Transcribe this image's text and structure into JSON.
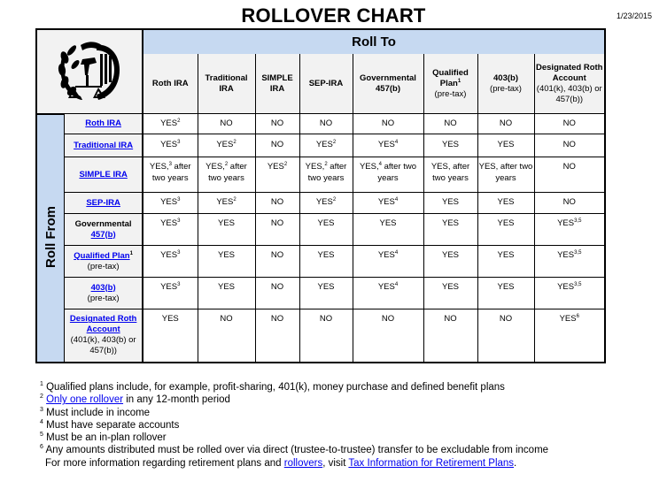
{
  "title": "ROLLOVER CHART",
  "date": "1/23/2015",
  "roll_to_label": "Roll To",
  "roll_from_label": "Roll From",
  "columns": [
    {
      "name": "Roth IRA",
      "sup": "",
      "sub": ""
    },
    {
      "name": "Traditional IRA",
      "sup": "",
      "sub": ""
    },
    {
      "name": "SIMPLE IRA",
      "sup": "",
      "sub": ""
    },
    {
      "name": "SEP-IRA",
      "sup": "",
      "sub": ""
    },
    {
      "name": "Governmental 457(b)",
      "sup": "",
      "sub": ""
    },
    {
      "name": "Qualified Plan",
      "sup": "1",
      "sub": "(pre-tax)"
    },
    {
      "name": "403(b)",
      "sup": "",
      "sub": "(pre-tax)"
    },
    {
      "name": "Designated Roth Account",
      "sup": "",
      "sub": "(401(k), 403(b) or 457(b))"
    }
  ],
  "rows": [
    {
      "plain": "",
      "link": "Roth IRA",
      "sup": "",
      "sub": "",
      "cells": [
        [
          "YES",
          "2",
          ""
        ],
        [
          "NO",
          "",
          ""
        ],
        [
          "NO",
          "",
          ""
        ],
        [
          "NO",
          "",
          ""
        ],
        [
          "NO",
          "",
          ""
        ],
        [
          "NO",
          "",
          ""
        ],
        [
          "NO",
          "",
          ""
        ],
        [
          "NO",
          "",
          ""
        ]
      ]
    },
    {
      "plain": "",
      "link": "Traditional IRA",
      "sup": "",
      "sub": "",
      "cells": [
        [
          "YES",
          "3",
          ""
        ],
        [
          "YES",
          "2",
          ""
        ],
        [
          "NO",
          "",
          ""
        ],
        [
          "YES",
          "2",
          ""
        ],
        [
          "YES",
          "4",
          ""
        ],
        [
          "YES",
          "",
          ""
        ],
        [
          "YES",
          "",
          ""
        ],
        [
          "NO",
          "",
          ""
        ]
      ]
    },
    {
      "plain": "",
      "link": "SIMPLE IRA",
      "sup": "",
      "sub": "",
      "cells": [
        [
          "YES,",
          "3",
          " after two years"
        ],
        [
          "YES,",
          "2",
          " after two years"
        ],
        [
          "YES",
          "2",
          ""
        ],
        [
          "YES,",
          "2",
          " after two years"
        ],
        [
          "YES,",
          "4",
          " after two years"
        ],
        [
          "YES, after two years",
          "",
          ""
        ],
        [
          "YES, after two years",
          "",
          ""
        ],
        [
          "NO",
          "",
          ""
        ]
      ]
    },
    {
      "plain": "",
      "link": "SEP-IRA",
      "sup": "",
      "sub": "",
      "cells": [
        [
          "YES",
          "3",
          ""
        ],
        [
          "YES",
          "2",
          ""
        ],
        [
          "NO",
          "",
          ""
        ],
        [
          "YES",
          "2",
          ""
        ],
        [
          "YES",
          "4",
          ""
        ],
        [
          "YES",
          "",
          ""
        ],
        [
          "YES",
          "",
          ""
        ],
        [
          "NO",
          "",
          ""
        ]
      ]
    },
    {
      "plain": "Governmental",
      "link": "457(b)",
      "sup": "",
      "sub": "",
      "cells": [
        [
          "YES",
          "3",
          ""
        ],
        [
          "YES",
          "",
          ""
        ],
        [
          "NO",
          "",
          ""
        ],
        [
          "YES",
          "",
          ""
        ],
        [
          "YES",
          "",
          ""
        ],
        [
          "YES",
          "",
          ""
        ],
        [
          "YES",
          "",
          ""
        ],
        [
          "YES",
          "3,5",
          ""
        ]
      ]
    },
    {
      "plain": "",
      "link": "Qualified Plan",
      "sup": "1",
      "sub": "(pre-tax)",
      "cells": [
        [
          "YES",
          "3",
          ""
        ],
        [
          "YES",
          "",
          ""
        ],
        [
          "NO",
          "",
          ""
        ],
        [
          "YES",
          "",
          ""
        ],
        [
          "YES",
          "4",
          ""
        ],
        [
          "YES",
          "",
          ""
        ],
        [
          "YES",
          "",
          ""
        ],
        [
          "YES",
          "3,5",
          ""
        ]
      ]
    },
    {
      "plain": "",
      "link": "403(b)",
      "sup": "",
      "sub": "(pre-tax)",
      "cells": [
        [
          "YES",
          "3",
          ""
        ],
        [
          "YES",
          "",
          ""
        ],
        [
          "NO",
          "",
          ""
        ],
        [
          "YES",
          "",
          ""
        ],
        [
          "YES",
          "4",
          ""
        ],
        [
          "YES",
          "",
          ""
        ],
        [
          "YES",
          "",
          ""
        ],
        [
          "YES",
          "3,5",
          ""
        ]
      ]
    },
    {
      "plain": "",
      "link": "Designated Roth Account",
      "sup": "",
      "sub": "(401(k), 403(b) or 457(b))",
      "cells": [
        [
          "YES",
          "",
          ""
        ],
        [
          "NO",
          "",
          ""
        ],
        [
          "NO",
          "",
          ""
        ],
        [
          "NO",
          "",
          ""
        ],
        [
          "NO",
          "",
          ""
        ],
        [
          "NO",
          "",
          ""
        ],
        [
          "NO",
          "",
          ""
        ],
        [
          "YES",
          "6",
          ""
        ]
      ]
    }
  ],
  "footnotes": {
    "n1": {
      "num": "1",
      "text": "Qualified plans include, for example, profit-sharing, 401(k), money purchase and defined benefit plans"
    },
    "n2": {
      "num": "2",
      "link": "Only one rollover",
      "text": " in any 12-month period"
    },
    "n3": {
      "num": "3",
      "text": "Must include in income"
    },
    "n4": {
      "num": "4",
      "text": "Must have separate accounts"
    },
    "n5": {
      "num": "5",
      "text": "Must be an in-plan rollover"
    },
    "n6": {
      "num": "6",
      "text": "Any amounts distributed must be rolled over via direct (trustee-to-trustee) transfer to be excludable from income"
    },
    "more": {
      "pre": "For more information regarding retirement plans and ",
      "link1": "rollovers",
      "mid": ", visit ",
      "link2": "Tax Information for Retirement Plans",
      "post": "."
    }
  },
  "logo": {
    "icon": "irs-eagle-logo-icon"
  }
}
